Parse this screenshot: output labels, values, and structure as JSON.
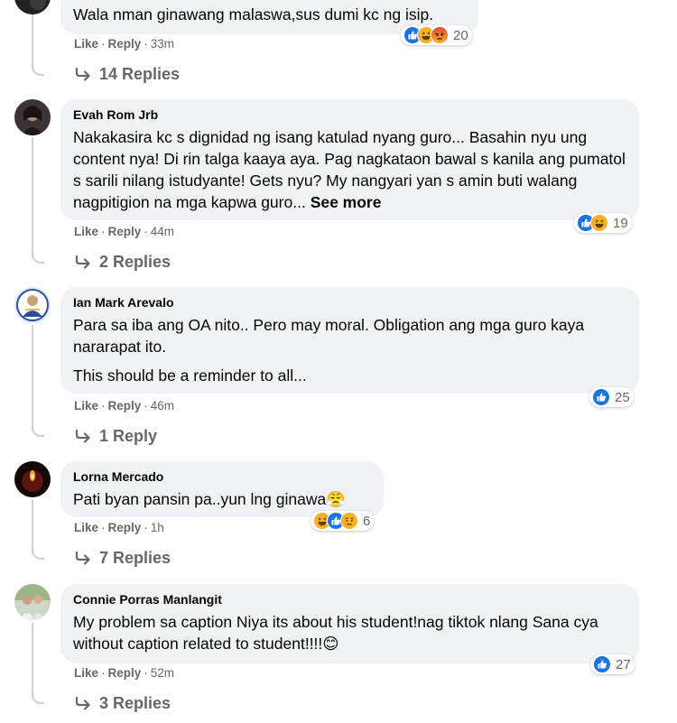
{
  "actions": {
    "like": "Like",
    "reply": "Reply",
    "sep": "·"
  },
  "comments": [
    {
      "author": "",
      "text": [
        "Wala nman ginawang malaswa,sus dumi kc ng isip."
      ],
      "time": "33m",
      "reactions": [
        "like",
        "haha",
        "angry"
      ],
      "reaction_count": "20",
      "replies": "14 Replies"
    },
    {
      "author": "Evah Rom Jrb",
      "text": [
        "Nakakasira kc s dignidad ng isang katulad nyang guro... Basahin nyu ung content nya! Di rin talga kaaya aya. Pag nagkataon bawal s kanila ang pumatol s sarili nilang istudyante! Gets nyu? My nangyari yan s amin buti walang nagpitigion na mga kapwa guro..."
      ],
      "see_more": "See more",
      "time": "44m",
      "reactions": [
        "like",
        "haha"
      ],
      "reaction_count": "19",
      "replies": "2 Replies"
    },
    {
      "author": "Ian Mark Arevalo",
      "text": [
        "Para sa iba ang OA nito.. Pero may moral. Obligation ang mga guro kaya nararapat ito.",
        "This should be a reminder to all..."
      ],
      "time": "46m",
      "reactions": [
        "like"
      ],
      "reaction_count": "25",
      "replies": "1 Reply"
    },
    {
      "author": "Lorna Mercado",
      "text": [
        "Pati byan pansin pa..yun lng ginawa😤"
      ],
      "time": "1h",
      "reactions": [
        "haha",
        "like",
        "sad"
      ],
      "reaction_count": "6",
      "replies": "7 Replies"
    },
    {
      "author": "Connie Porras Manlangit",
      "text": [
        "My problem sa caption Niya its about his student!nag tiktok nlang Sana cya without caption related to student!!!!😊"
      ],
      "time": "52m",
      "reactions": [
        "like"
      ],
      "reaction_count": "27",
      "replies": "3 Replies"
    }
  ]
}
